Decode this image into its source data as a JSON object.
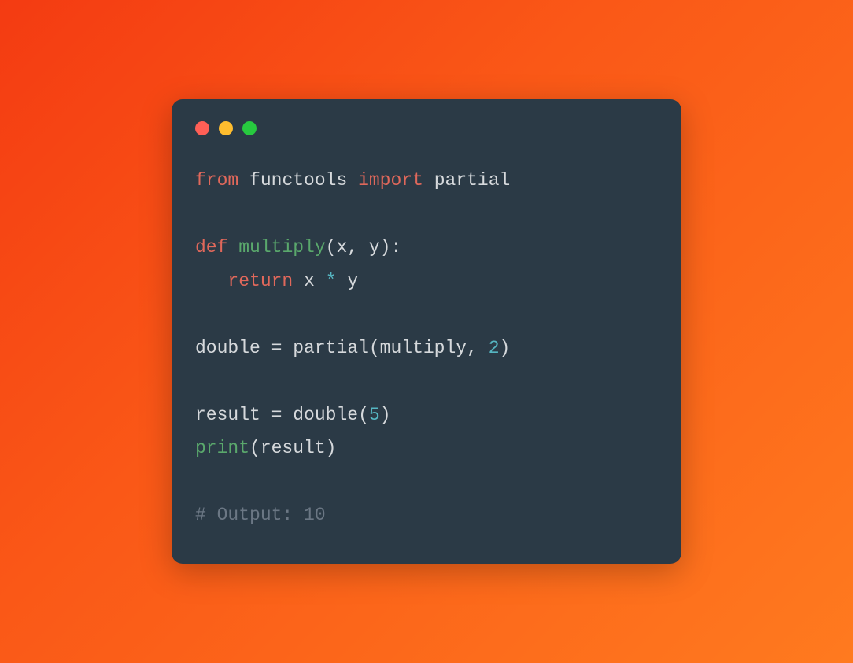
{
  "traffic_lights": [
    "red",
    "yellow",
    "green"
  ],
  "code": {
    "line1": {
      "kw_from": "from",
      "mod": "functools",
      "kw_import": "import",
      "name": "partial"
    },
    "line3": {
      "kw_def": "def",
      "fn": "multiply",
      "params": "(x, y):"
    },
    "line4": {
      "kw_return": "return",
      "expr_x": "x",
      "op": "*",
      "expr_y": "y"
    },
    "line6": {
      "lhs": "double",
      "eq": " = ",
      "call": "partial(multiply, ",
      "num": "2",
      "close": ")"
    },
    "line8": {
      "lhs": "result",
      "eq": " = ",
      "call": "double(",
      "num": "5",
      "close": ")"
    },
    "line9": {
      "fn": "print",
      "arg": "(result)"
    },
    "line11": {
      "comment": "# Output: 10"
    }
  }
}
